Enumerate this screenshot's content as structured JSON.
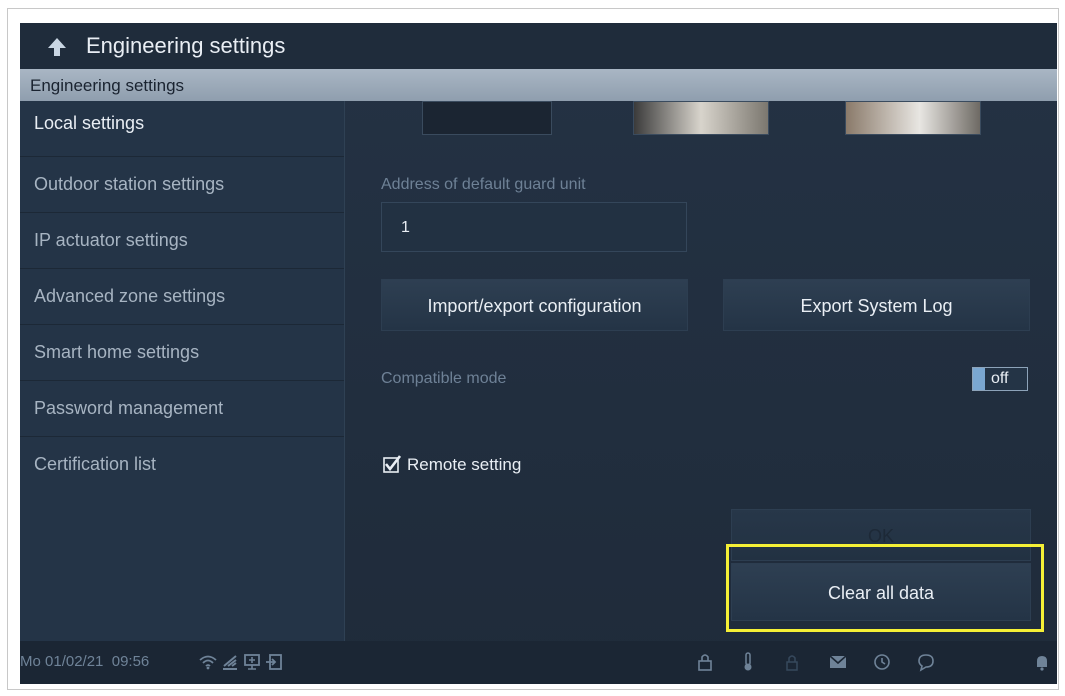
{
  "header": {
    "title": "Engineering settings",
    "subheader": "Engineering settings"
  },
  "sidebar": {
    "items": [
      {
        "label": "Local settings"
      },
      {
        "label": "Outdoor station settings"
      },
      {
        "label": "IP actuator settings"
      },
      {
        "label": "Advanced zone settings"
      },
      {
        "label": "Smart home settings"
      },
      {
        "label": "Password management"
      },
      {
        "label": "Certification list"
      }
    ]
  },
  "main": {
    "guard_label": "Address of default guard unit",
    "guard_value": "1",
    "import_export_label": "Import/export configuration",
    "export_log_label": "Export System Log",
    "compatible_label": "Compatible mode",
    "compatible_state": "off",
    "remote_label": "Remote setting",
    "remote_checked": true,
    "ok_label": "OK",
    "clear_label": "Clear all data"
  },
  "status": {
    "datetime": "Mo 01/02/21  09:56",
    "icons": [
      "wifi-icon",
      "signal-icon",
      "screen-icon",
      "exit-icon",
      "lock-icon",
      "thermometer-icon",
      "lock-small-icon",
      "mail-icon",
      "history-icon",
      "chat-icon",
      "bell-icon"
    ]
  },
  "colors": {
    "background": "#1f2b3a",
    "accent": "#7aa7d1",
    "highlight": "#f5f036"
  }
}
